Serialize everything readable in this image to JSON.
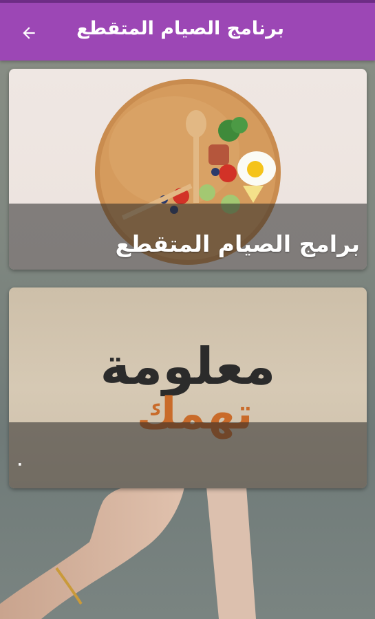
{
  "app_bar": {
    "title": "برنامج الصيام المتقطع",
    "back_icon": "arrow-left-icon",
    "color": "#9c47b5"
  },
  "cards": [
    {
      "title": "برامج الصيام المتقطع",
      "image": "food-plate-clock-image"
    },
    {
      "title": ".",
      "image": "information-concerns-you-image",
      "image_text_line1": "معلومة",
      "image_text_line2": "تهمك"
    }
  ]
}
